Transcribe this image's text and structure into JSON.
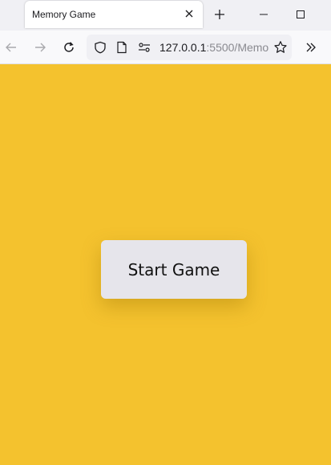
{
  "browser": {
    "tab": {
      "title": "Memory Game"
    },
    "nav": {
      "url_host": "127.0.0.1",
      "url_rest": ":5500/Memo"
    },
    "icons": {
      "close_tab": "close-icon",
      "new_tab": "plus-icon",
      "minimize": "minimize-icon",
      "maximize": "maximize-icon",
      "back": "arrow-left-icon",
      "forward": "arrow-right-icon",
      "reload": "reload-icon",
      "shield": "shield-icon",
      "page": "page-icon",
      "permissions": "permissions-icon",
      "bookmark": "star-icon",
      "overflow": "chevron-double-right-icon"
    }
  },
  "page": {
    "background": "#f4c22e",
    "start_button": {
      "label": "Start Game"
    }
  }
}
